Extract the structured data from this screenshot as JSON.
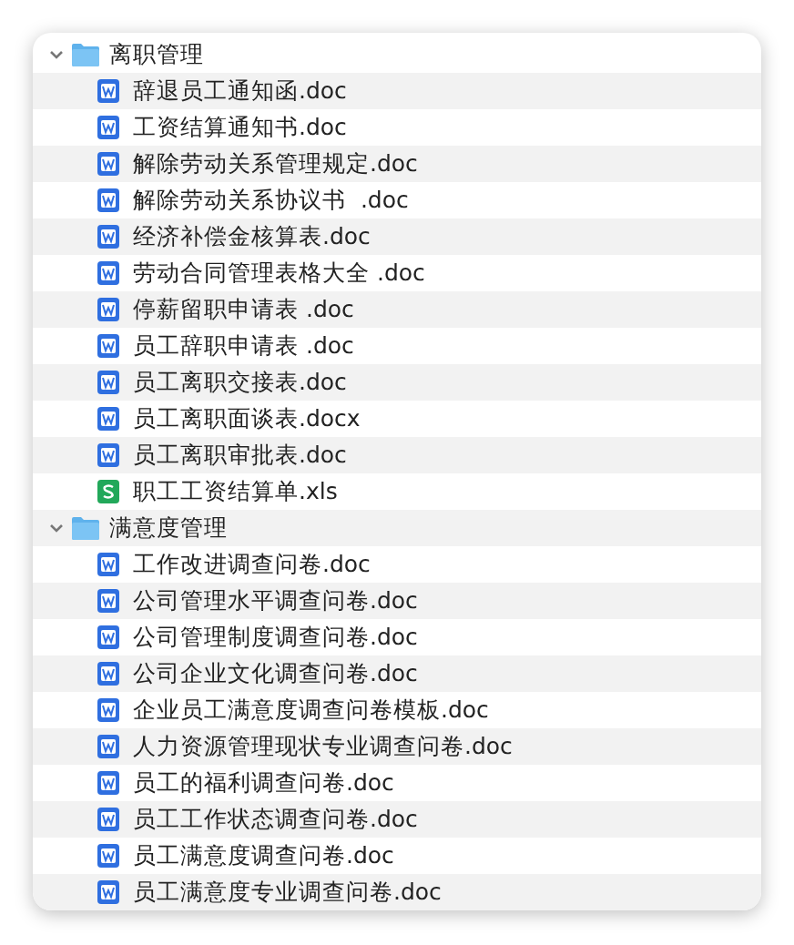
{
  "folders": [
    {
      "name": "离职管理",
      "expanded": true,
      "children": [
        {
          "name": "辞退员工通知函.doc",
          "kind": "word"
        },
        {
          "name": "工资结算通知书.doc",
          "kind": "word"
        },
        {
          "name": "解除劳动关系管理规定.doc",
          "kind": "word"
        },
        {
          "name": "解除劳动关系协议书  .doc",
          "kind": "word"
        },
        {
          "name": "经济补偿金核算表.doc",
          "kind": "word"
        },
        {
          "name": "劳动合同管理表格大全 .doc",
          "kind": "word"
        },
        {
          "name": "停薪留职申请表 .doc",
          "kind": "word"
        },
        {
          "name": "员工辞职申请表 .doc",
          "kind": "word"
        },
        {
          "name": "员工离职交接表.doc",
          "kind": "word"
        },
        {
          "name": "员工离职面谈表.docx",
          "kind": "word"
        },
        {
          "name": "员工离职审批表.doc",
          "kind": "word"
        },
        {
          "name": "职工工资结算单.xls",
          "kind": "sheet"
        }
      ]
    },
    {
      "name": "满意度管理",
      "expanded": true,
      "children": [
        {
          "name": "工作改进调查问卷.doc",
          "kind": "word"
        },
        {
          "name": "公司管理水平调查问卷.doc",
          "kind": "word"
        },
        {
          "name": "公司管理制度调查问卷.doc",
          "kind": "word"
        },
        {
          "name": "公司企业文化调查问卷.doc",
          "kind": "word"
        },
        {
          "name": "企业员工满意度调查问卷模板.doc",
          "kind": "word"
        },
        {
          "name": "人力资源管理现状专业调查问卷.doc",
          "kind": "word"
        },
        {
          "name": "员工的福利调查问卷.doc",
          "kind": "word"
        },
        {
          "name": "员工工作状态调查问卷.doc",
          "kind": "word"
        },
        {
          "name": "员工满意度调查问卷.doc",
          "kind": "word"
        },
        {
          "name": "员工满意度专业调查问卷.doc",
          "kind": "word"
        }
      ]
    }
  ]
}
